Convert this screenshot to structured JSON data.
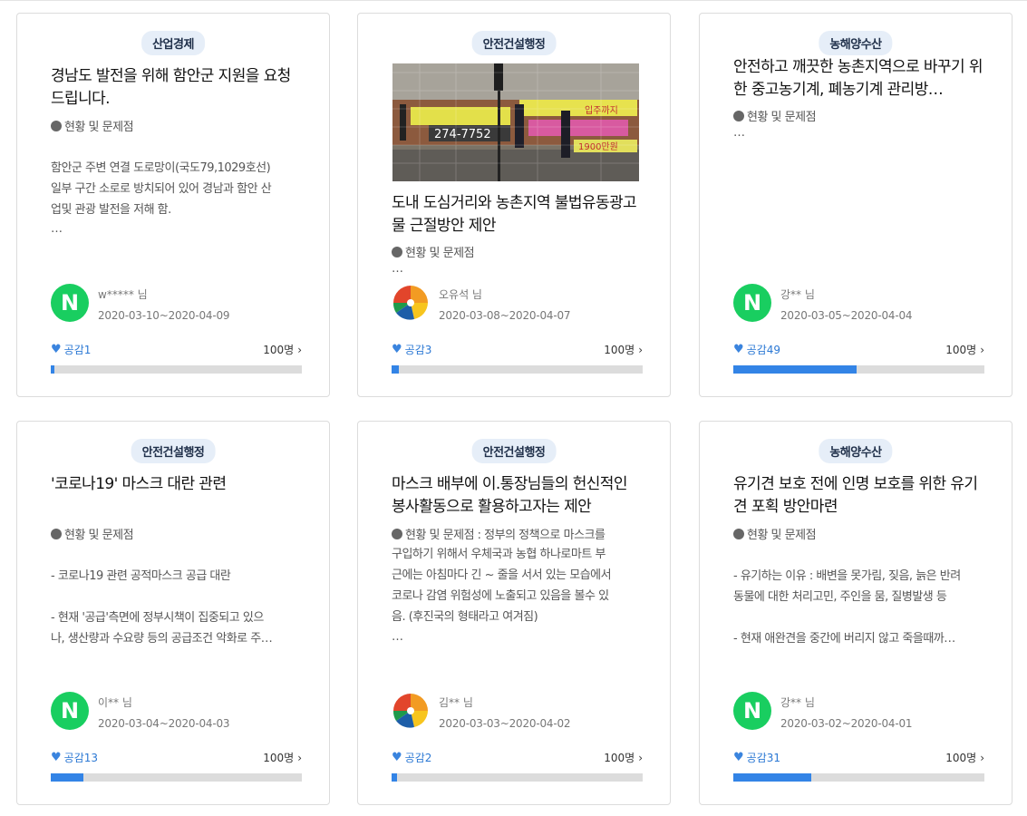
{
  "cards": [
    {
      "category": "산업경제",
      "title": "경남도 발전을 위해 함안군 지원을 요청 드립니다.",
      "subtitle": "현황 및 문제점",
      "body": "함안군 주변 연결 도로망이(국도79,1029호선)\n일부 구간 소로로 방치되어 있어 경남과 함안 산\n업및 관광 발전을 저해 함.",
      "ellipsis": "…",
      "user": "w***** 님",
      "date": "2020-03-10~2020-04-09",
      "likes": "공감1",
      "target": "100명",
      "progress": 0.01,
      "avatar": "naver-icon"
    },
    {
      "category": "안전건설행정",
      "title": "도내 도심거리와 농촌지역 불법유동광고물 근절방안 제안",
      "subtitle": "현황 및 문제점",
      "body": "",
      "ellipsis": "…",
      "user": "오유석 님",
      "date": "2020-03-08~2020-04-07",
      "likes": "공감3",
      "target": "100명",
      "progress": 0.03,
      "avatar": "gyeongnam-logo-icon",
      "thumbnail": {
        "text_a": "274-7752",
        "text_b": "입주까지",
        "text_c": "1900만원"
      }
    },
    {
      "category": "농해양수산",
      "title": "안전하고 깨끗한 농촌지역으로 바꾸기 위한 중고농기계, 폐농기계 관리방…",
      "subtitle": "현황 및 문제점",
      "body": "",
      "ellipsis": "…",
      "user": "강** 님",
      "date": "2020-03-05~2020-04-04",
      "likes": "공감49",
      "target": "100명",
      "progress": 0.49,
      "avatar": "naver-icon"
    },
    {
      "category": "안전건설행정",
      "title": "'코로나19' 마스크 대란 관련",
      "subtitle": "현황 및 문제점",
      "body": " - 코로나19 관련 공적마스크 공급 대란\n\n - 현재 '공급'측면에 정부시책이 집중되고 있으\n나, 생산량과 수요량 등의 공급조건 악화로 주…",
      "ellipsis": "",
      "user": "이** 님",
      "date": "2020-03-04~2020-04-03",
      "likes": "공감13",
      "target": "100명",
      "progress": 0.13,
      "avatar": "naver-icon"
    },
    {
      "category": "안전건설행정",
      "title": "마스크 배부에 이.통장님들의 헌신적인 봉사활동으로 활용하고자는 제안",
      "subtitle": "현황 및 문제점 : 정부의 정책으로 마스크를",
      "body": "구입하기 위해서 우체국과 농협 하나로마트 부\n근에는 아침마다 긴 ~ 줄을 서서 있는 모습에서\n코로나 감염 위험성에 노출되고 있음을 볼수 있\n음. (후진국의 형태라고 여겨짐)",
      "ellipsis": "…",
      "user": "김** 님",
      "date": "2020-03-03~2020-04-02",
      "likes": "공감2",
      "target": "100명",
      "progress": 0.02,
      "avatar": "gyeongnam-logo-icon"
    },
    {
      "category": "농해양수산",
      "title": "유기견 보호 전에 인명 보호를 위한 유기견 포획 방안마련",
      "subtitle": "현황 및 문제점",
      "body": "- 유기하는 이유 : 배변을 못가림, 짖음, 늙은 반려\n동물에 대한 처리고민, 주인을 뭄, 질병발생 등\n\n- 현재 애완견을 중간에 버리지 않고 죽을때까…",
      "ellipsis": "",
      "user": "강** 님",
      "date": "2020-03-02~2020-04-01",
      "likes": "공감31",
      "target": "100명",
      "progress": 0.31,
      "avatar": "naver-icon"
    }
  ],
  "colors": {
    "accent": "#3384e6",
    "naver": "#19ce60",
    "badge_bg": "#e6eef8"
  }
}
